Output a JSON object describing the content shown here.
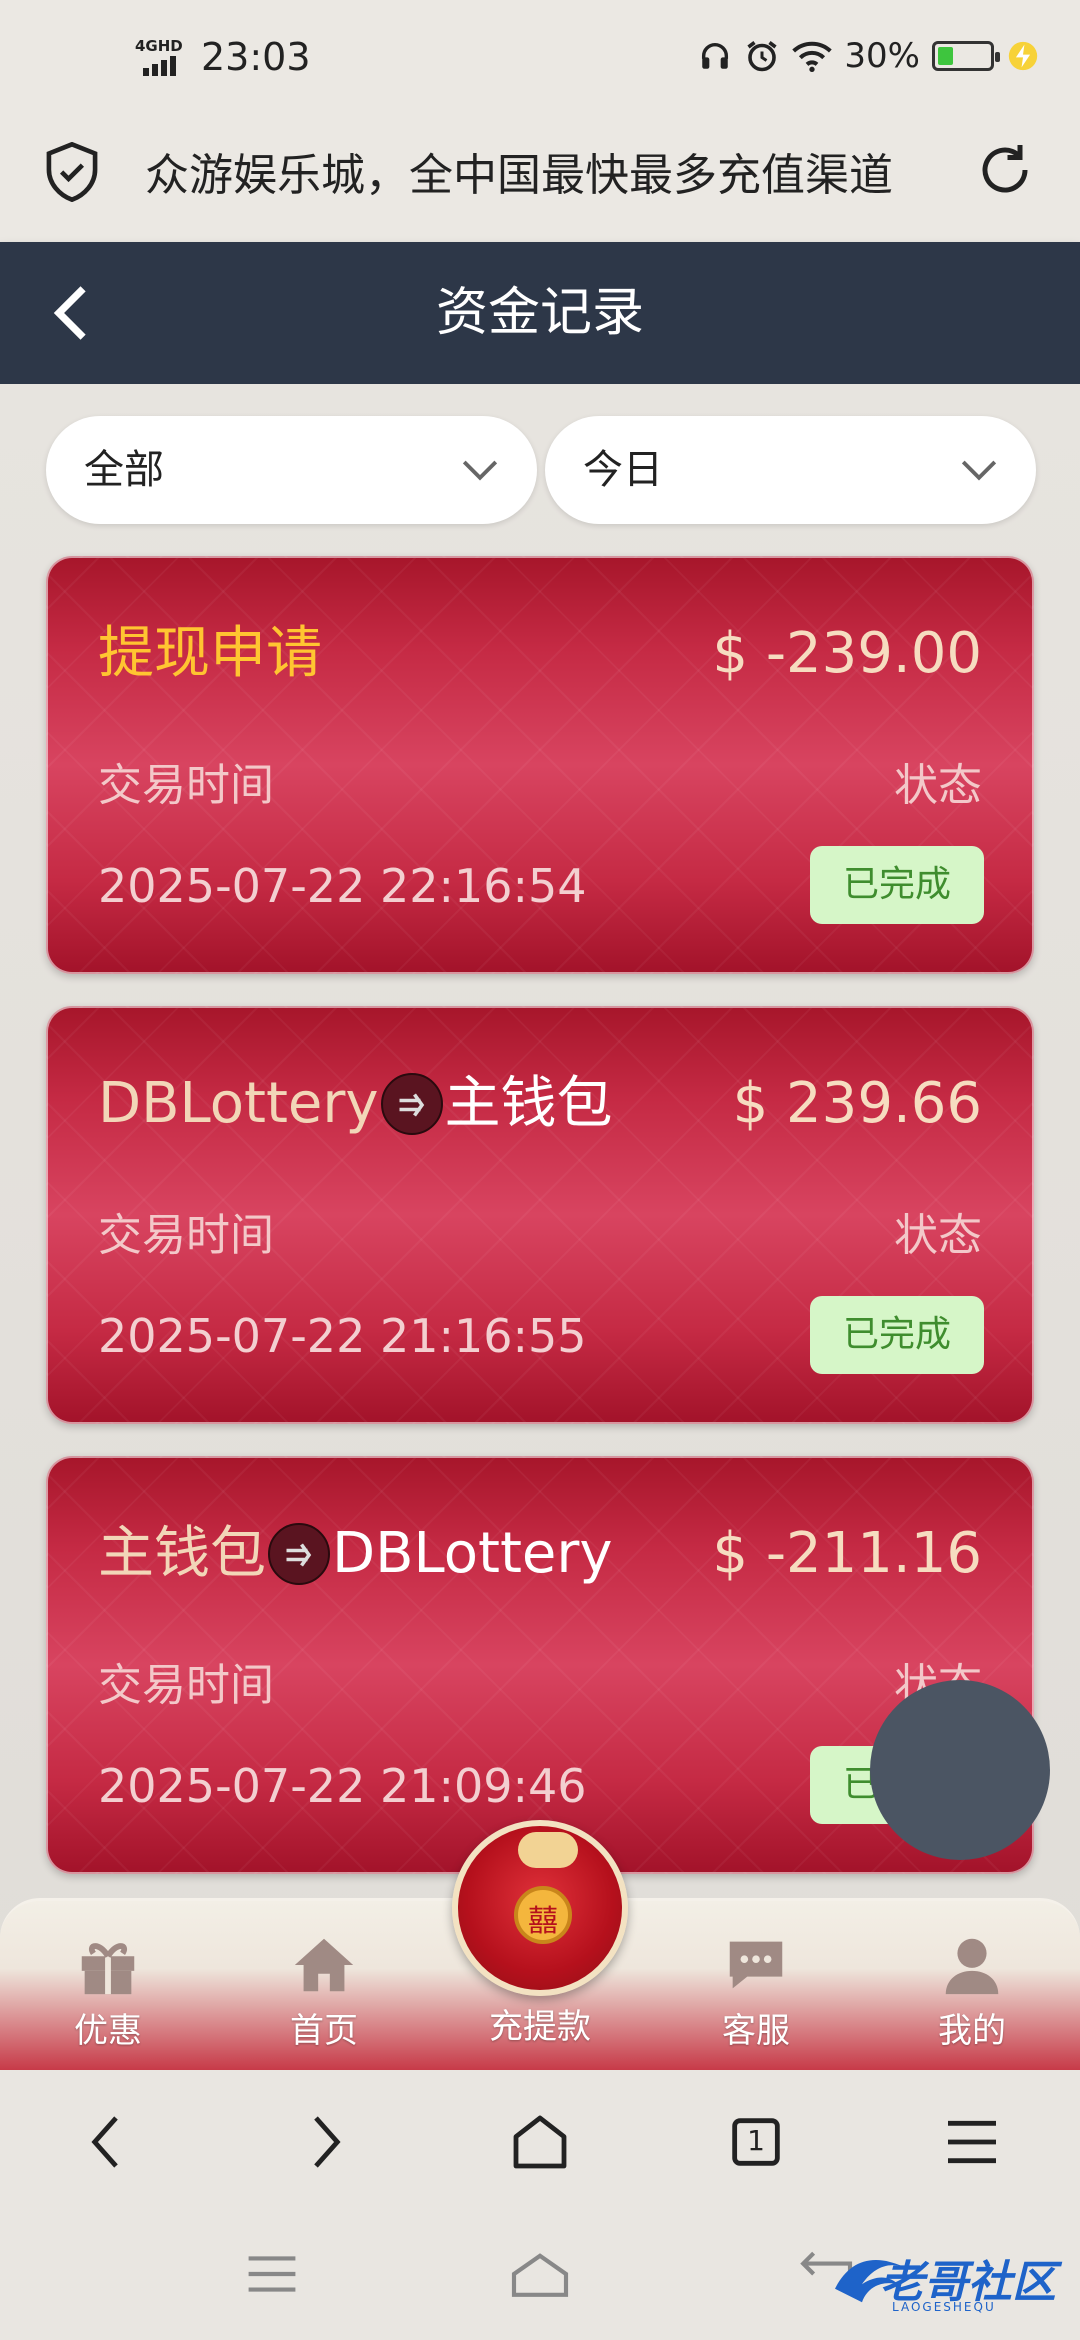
{
  "status_bar": {
    "network": "4GHD",
    "time": "23:03",
    "battery_percent": "30%",
    "battery_level": 0.3
  },
  "browser": {
    "url_text": "众游娱乐城，全中国最快最多充值渠道"
  },
  "header": {
    "title": "资金记录"
  },
  "filters": {
    "type": "全部",
    "period": "今日"
  },
  "records": [
    {
      "name": "提现申请",
      "from": "",
      "to": "",
      "amount": "$ -239.00",
      "time_label": "交易时间",
      "status_label": "状态",
      "time": "2025-07-22 22:16:54",
      "status": "已完成"
    },
    {
      "name": "",
      "from": "DBLottery",
      "to": "主钱包",
      "amount": "$ 239.66",
      "time_label": "交易时间",
      "status_label": "状态",
      "time": "2025-07-22 21:16:55",
      "status": "已完成"
    },
    {
      "name": "",
      "from": "主钱包",
      "to": "DBLottery",
      "amount": "$ -211.16",
      "time_label": "交易时间",
      "status_label": "状态",
      "time": "2025-07-22 21:09:46",
      "status": "已完成"
    }
  ],
  "tabbar": {
    "tabs": [
      {
        "label": "优惠",
        "icon": "gift-icon"
      },
      {
        "label": "首页",
        "icon": "home-icon"
      },
      {
        "label": "充提款",
        "icon": "money-bag-icon"
      },
      {
        "label": "客服",
        "icon": "chat-icon"
      },
      {
        "label": "我的",
        "icon": "user-icon"
      }
    ]
  },
  "browser_nav": {
    "tab_count": "1"
  },
  "watermark": {
    "text": "老哥社区",
    "sub": "LAOGESHEQU"
  },
  "colors": {
    "header_bg": "#2d3748",
    "card_red": "#c52a44",
    "gold": "#ffc531",
    "badge_bg": "#d6f6c8",
    "badge_text": "#3f8d2e"
  }
}
